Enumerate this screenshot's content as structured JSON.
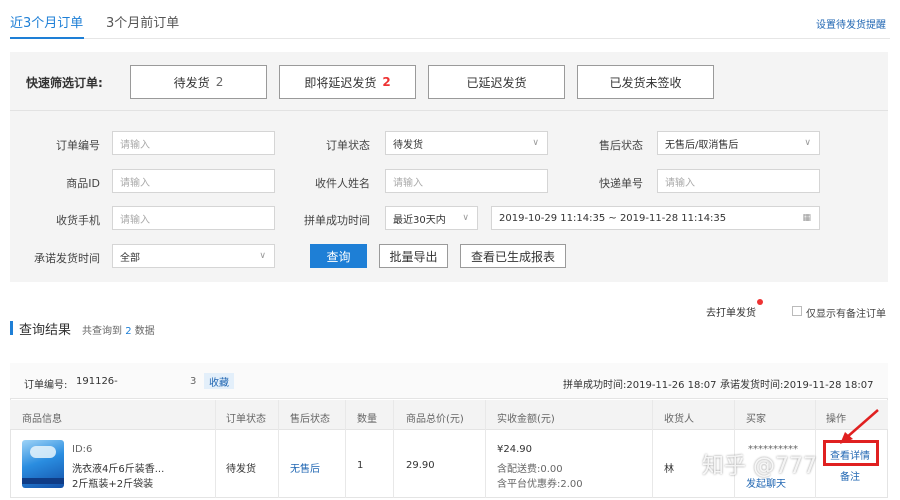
{
  "tabs": [
    {
      "label": "近3个月订单",
      "active": true
    },
    {
      "label": "3个月前订单",
      "active": false
    }
  ],
  "top_link": "设置待发货提醒",
  "quick_filter": {
    "label": "快速筛选订单:",
    "buttons": [
      {
        "label": "待发货",
        "count": "2"
      },
      {
        "label": "即将延迟发货",
        "count": "2"
      },
      {
        "label": "已延迟发货",
        "count": ""
      },
      {
        "label": "已发货未签收",
        "count": ""
      }
    ]
  },
  "form": {
    "order_no": {
      "label": "订单编号",
      "placeholder": "请输入"
    },
    "order_status": {
      "label": "订单状态",
      "value": "待发货"
    },
    "after_sale": {
      "label": "售后状态",
      "value": "无售后/取消售后"
    },
    "product_id": {
      "label": "商品ID",
      "placeholder": "请输入"
    },
    "receiver": {
      "label": "收件人姓名",
      "placeholder": "请输入"
    },
    "tracking_no": {
      "label": "快递单号",
      "placeholder": "请输入"
    },
    "phone": {
      "label": "收货手机",
      "placeholder": "请输入"
    },
    "group_time": {
      "label": "拼单成功时间",
      "range": "最近30天内",
      "dates": "2019-10-29 11:14:35 ~ 2019-11-28 11:14:35"
    },
    "promise_time": {
      "label": "承诺发货时间",
      "value": "全部"
    }
  },
  "actions": {
    "query": "查询",
    "export": "批量导出",
    "report": "查看已生成报表"
  },
  "results": {
    "title": "查询结果",
    "count_prefix": "共查询到",
    "count": "2",
    "count_suffix": "数据",
    "print_link": "去打单发货",
    "only_remark": "仅显示有备注订单"
  },
  "order": {
    "no_label": "订单编号:",
    "no_value": "191126-",
    "no_tail": "3",
    "fav": "收藏",
    "group_time": "拼单成功时间:2019-11-26 18:07",
    "promise_time": "承诺发货时间:2019-11-28 18:07",
    "columns": [
      "商品信息",
      "订单状态",
      "售后状态",
      "数量",
      "商品总价(元)",
      "实收金额(元)",
      "收货人",
      "买家",
      "操作"
    ],
    "row": {
      "product_id": "ID:6",
      "product_title": "洗衣液4斤6斤装香...",
      "product_spec": "2斤瓶装+2斤袋装",
      "status": "待发货",
      "after_sale": "无售后",
      "qty": "1",
      "total": "29.90",
      "paid": "¥24.90",
      "shipping": "含配送费:0.00",
      "coupon": "含平台优惠券:2.00",
      "receiver": "林",
      "buyer": "**********",
      "chat": "发起聊天",
      "op_1": "查看详情",
      "op_2": "备注"
    }
  },
  "watermark": "知乎 @777"
}
